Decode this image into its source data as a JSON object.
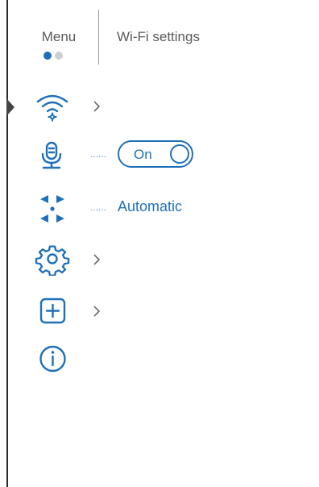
{
  "colors": {
    "accent": "#1f70b8",
    "text_muted": "#5a5a5a",
    "dot_inactive": "#cfcfcf",
    "border": "#2a2a2a"
  },
  "header": {
    "menu_tab_label": "Menu",
    "wifi_tab_label": "Wi-Fi settings",
    "page_count": 2,
    "current_page": 1
  },
  "items": [
    {
      "icon": "wifi-settings-icon",
      "has_submenu": true,
      "selected": true
    },
    {
      "icon": "microphone-icon",
      "control": "toggle",
      "value": "On",
      "state": true
    },
    {
      "icon": "auto-focus-icon",
      "control": "value",
      "value": "Automatic"
    },
    {
      "icon": "gear-icon",
      "has_submenu": true
    },
    {
      "icon": "plus-square-icon",
      "has_submenu": true
    },
    {
      "icon": "info-icon",
      "has_submenu": false
    }
  ]
}
